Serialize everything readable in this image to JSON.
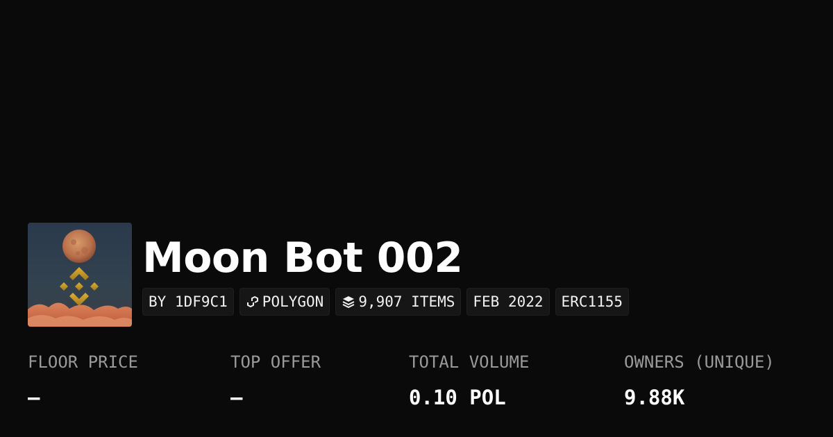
{
  "collection": {
    "name": "Moon Bot 002"
  },
  "tags": [
    {
      "label": "BY 1DF9C1",
      "icon": ""
    },
    {
      "label": "POLYGON",
      "icon": "polygon-chain-icon"
    },
    {
      "label": "9,907 ITEMS",
      "icon": "layers-icon"
    },
    {
      "label": "FEB 2022",
      "icon": ""
    },
    {
      "label": "ERC1155",
      "icon": ""
    }
  ],
  "stats": [
    {
      "label": "FLOOR PRICE",
      "value": "–"
    },
    {
      "label": "TOP OFFER",
      "value": "–"
    },
    {
      "label": "TOTAL VOLUME",
      "value": "0.10 POL"
    },
    {
      "label": "OWNERS (UNIQUE)",
      "value": "9.88K"
    }
  ],
  "colors": {
    "background": "#0a0a0a",
    "tag_background": "#161616",
    "label_gray": "#9a9a9a",
    "text": "#ffffff"
  }
}
